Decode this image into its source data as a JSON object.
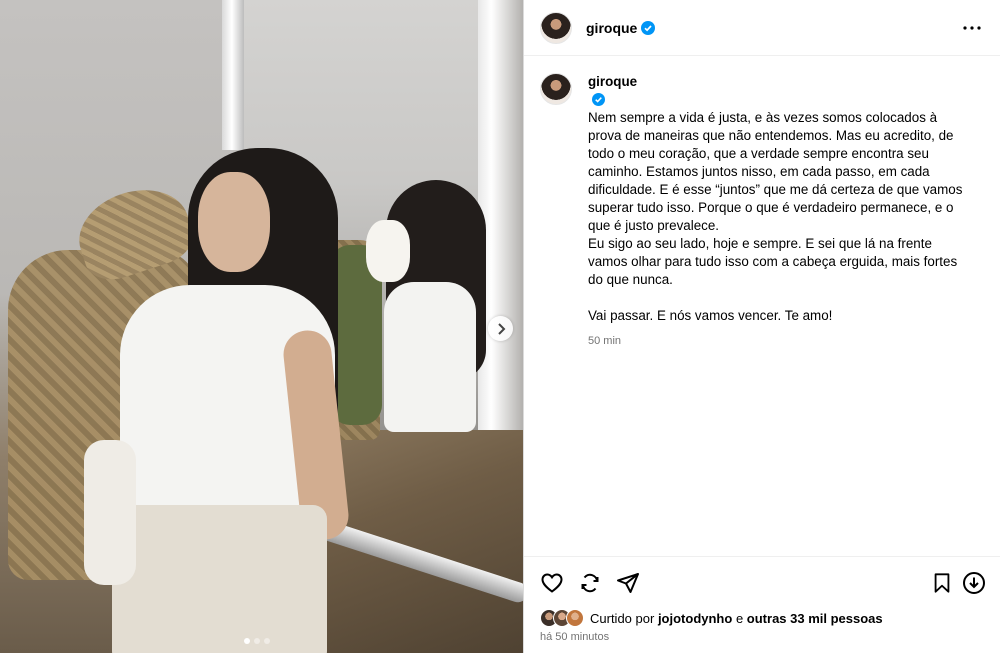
{
  "post": {
    "username": "giroque",
    "caption_lines": [
      "Nem sempre a vida é justa, e às vezes somos colocados à prova de maneiras que não entendemos. Mas eu acredito, de todo o meu coração, que a verdade sempre encontra seu caminho. Estamos juntos nisso, em cada passo, em cada dificuldade. E é esse “juntos” que me dá certeza de que vamos superar tudo isso. Porque o que é verdadeiro permanece, e o que é justo prevalece.",
      "Eu sigo ao seu lado, hoje e sempre. E sei que lá na frente vamos olhar para tudo isso com a cabeça erguida, mais fortes do que nunca.",
      "",
      "Vai passar. E nós vamos vencer. Te amo!"
    ],
    "caption_time": "50 min",
    "likes_prefix": "Curtido por",
    "likes_user": "jojotodynho",
    "likes_conj": "e",
    "likes_others": "outras 33 mil pessoas",
    "posted_ago": "há 50 minutos",
    "carousel": {
      "total": 3,
      "current": 1
    }
  },
  "icons": {
    "verified": "verified-badge-icon",
    "more": "more-options-icon",
    "like": "heart-icon",
    "comment": "comment-icon",
    "share": "paper-plane-icon",
    "save": "bookmark-icon",
    "download": "download-icon",
    "next": "chevron-right-icon"
  },
  "colors": {
    "verified_blue": "#0095f6",
    "secondary_text": "#737373",
    "border": "#dbdbdb"
  }
}
